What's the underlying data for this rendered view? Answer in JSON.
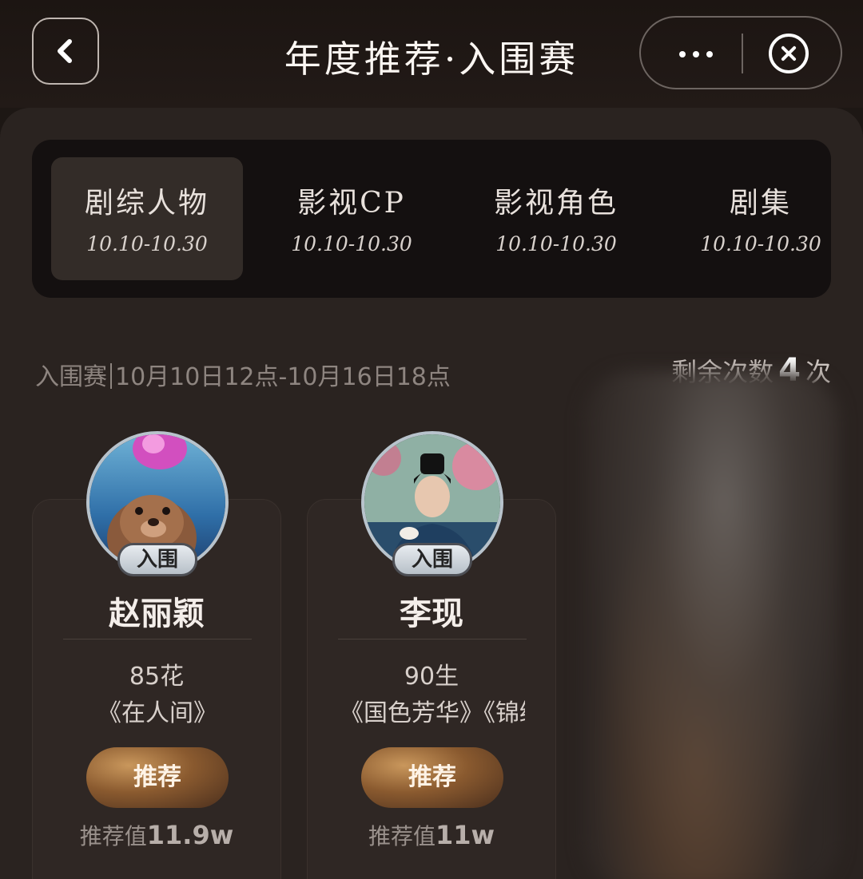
{
  "header": {
    "title": "年度推荐·入围赛",
    "back_icon": "chevron-left-icon",
    "more_icon": "more-dots-icon",
    "close_icon": "close-circle-icon"
  },
  "tabs": [
    {
      "label": "剧综人物",
      "date": "10.10-10.30",
      "active": true
    },
    {
      "label": "影视CP",
      "date": "10.10-10.30",
      "active": false
    },
    {
      "label": "影视角色",
      "date": "10.10-10.30",
      "active": false
    },
    {
      "label": "剧集",
      "date": "10.10-10.30",
      "active": false
    }
  ],
  "round": {
    "name": "入围赛",
    "time": "10月10日12点-10月16日18点",
    "remaining_prefix": "剩余次数",
    "remaining_count": "4",
    "remaining_suffix": "次"
  },
  "cards": [
    {
      "badge": "入围",
      "name": "赵丽颖",
      "tag": "85花",
      "works": "《在人间》",
      "button": "推荐",
      "value_label": "推荐值",
      "value": "11.9w"
    },
    {
      "badge": "入围",
      "name": "李现",
      "tag": "90生",
      "works": "《国色芳华》《锦绣",
      "button": "推荐",
      "value_label": "推荐值",
      "value": "11w"
    }
  ],
  "colors": {
    "background": "#1d1714",
    "panel": "#2a2320",
    "button_gold": "#c9975c"
  }
}
